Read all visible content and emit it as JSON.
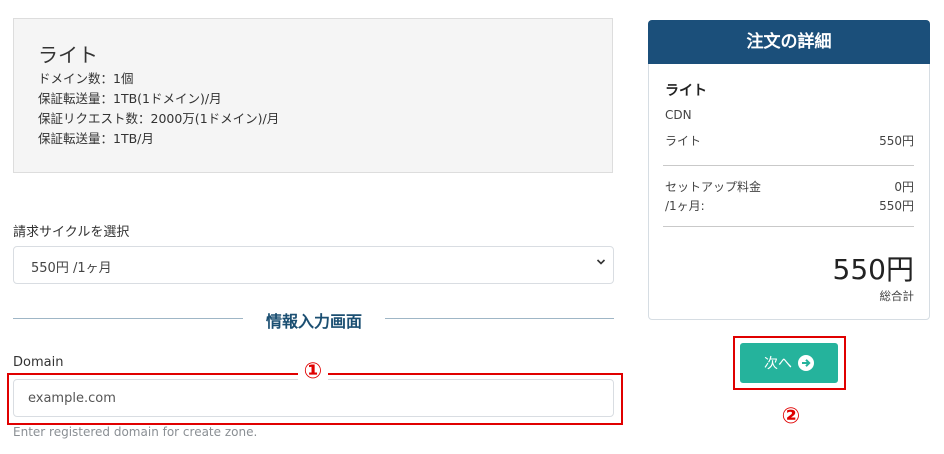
{
  "plan": {
    "name": "ライト",
    "features": [
      "ドメイン数：1個",
      "保証転送量：1TB(1ドメイン)/月",
      "保証リクエスト数：2000万(1ドメイン)/月",
      "保証転送量：1TB/月"
    ]
  },
  "billing": {
    "label": "請求サイクルを選択",
    "selected": "550円 /1ヶ月"
  },
  "section": {
    "title": "情報入力画面"
  },
  "domain": {
    "label": "Domain",
    "placeholder": "example.com",
    "value": "",
    "help": "Enter registered domain for create zone."
  },
  "annotations": {
    "marker_1": "①",
    "marker_2": "②"
  },
  "order": {
    "header": "注文の詳細",
    "plan_name": "ライト",
    "service": "CDN",
    "plan_row": {
      "label": "ライト",
      "price": "550円"
    },
    "setup_row": {
      "label": "セットアップ料金",
      "price": "0円"
    },
    "monthly_row": {
      "label": "/1ヶ月:",
      "price": "550円"
    },
    "total": "550円",
    "total_label": "総合計"
  },
  "next_button": {
    "label": "次へ"
  },
  "colors": {
    "header_bg": "#1b4f7a",
    "button_bg": "#25b39c",
    "annotation_red": "#e00000",
    "section_title": "#1b4f72"
  }
}
